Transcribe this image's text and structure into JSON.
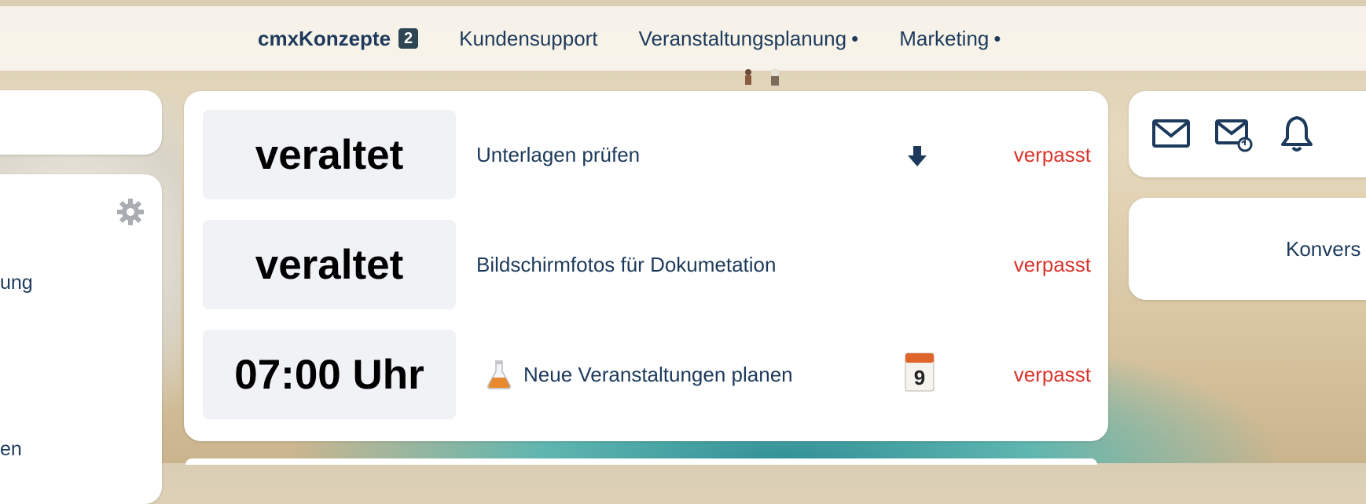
{
  "nav": {
    "items": [
      {
        "label": "cmxKonzepte",
        "badge": "2"
      },
      {
        "label": "Kundensupport"
      },
      {
        "label": "Veranstaltungsplanung",
        "dot": "•"
      },
      {
        "label": "Marketing",
        "dot": "•"
      }
    ]
  },
  "left": {
    "text1": "ung",
    "text2": "en"
  },
  "tasks": [
    {
      "time": "veraltet",
      "label": "Unterlagen prüfen",
      "status": "verpasst",
      "icon": "download-arrow-icon"
    },
    {
      "time": "veraltet",
      "label": "Bildschirmfotos für Dokumetation",
      "status": "verpasst"
    },
    {
      "time": "07:00 Uhr",
      "label": "Neue Veranstaltungen planen",
      "status": "verpasst",
      "lead_icon": "flask-icon",
      "icon": "calendar-icon"
    }
  ],
  "right": {
    "icons": [
      "mail-icon",
      "mail-sync-icon",
      "bell-icon"
    ],
    "conversation_label": "Konvers"
  },
  "colors": {
    "text": "#1d3a5c",
    "missed": "#d9342b",
    "badge": "#2e4653",
    "time_box": "#f1f2f5"
  }
}
